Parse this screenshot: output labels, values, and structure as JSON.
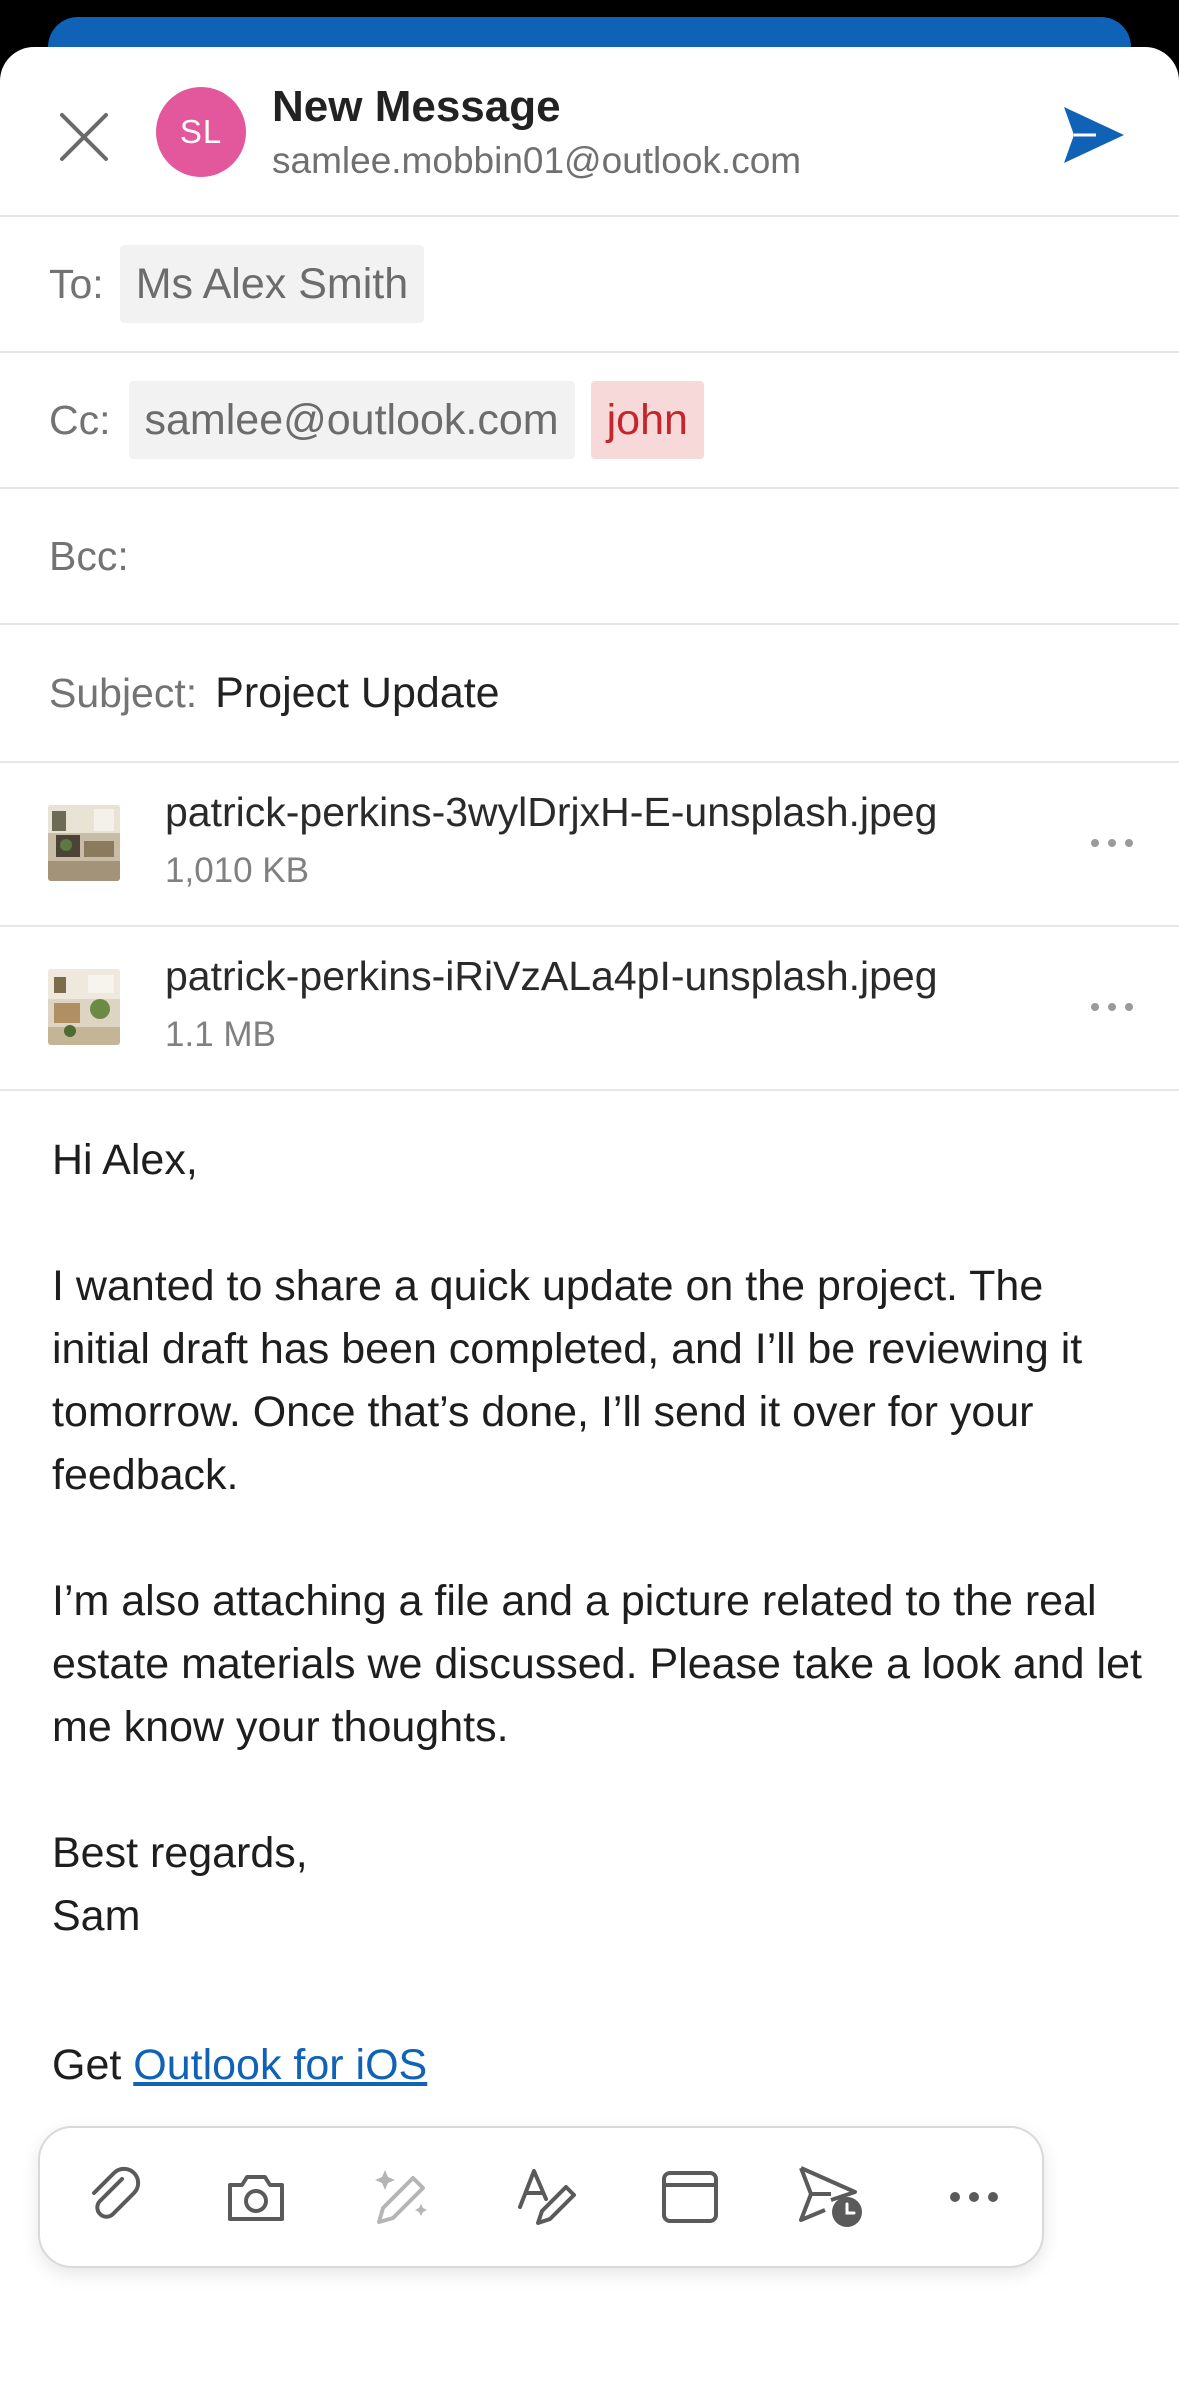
{
  "header": {
    "avatar_initials": "SL",
    "avatar_color": "#e3589d",
    "title": "New Message",
    "account": "samlee.mobbin01@outlook.com",
    "close_icon": "close-icon",
    "send_icon": "send-icon",
    "accent_color": "#0f62b5"
  },
  "recipients": {
    "to_label": "To:",
    "to": [
      "Ms Alex Smith"
    ],
    "cc_label": "Cc:",
    "cc": [
      "samlee@outlook.com",
      "john"
    ],
    "bcc_label": "Bcc:"
  },
  "subject": {
    "label": "Subject:",
    "value": "Project Update"
  },
  "attachments": [
    {
      "name": "patrick-perkins-3wylDrjxH-E-unsplash.jpeg",
      "size": "1,010 KB"
    },
    {
      "name": "patrick-perkins-iRiVzALa4pI-unsplash.jpeg",
      "size": "1.1 MB"
    }
  ],
  "body": {
    "greeting": "Hi Alex,",
    "paragraph1": "I wanted to share a quick update on the project. The initial draft has been completed, and I’ll be reviewing it tomorrow. Once that’s done, I’ll send it over for your feedback.",
    "paragraph2": "I’m also attaching a file and a picture related to the real estate materials we discussed. Please take a look and let me know your thoughts.",
    "closing": "Best regards,",
    "name": "Sam"
  },
  "signature": {
    "prefix": "Get ",
    "link_text": "Outlook for iOS"
  },
  "toolbar": {
    "icons": [
      "paperclip-icon",
      "camera-icon",
      "ai-sparkle-pen-icon",
      "format-text-icon",
      "calendar-icon",
      "schedule-send-icon",
      "more-icon"
    ]
  }
}
